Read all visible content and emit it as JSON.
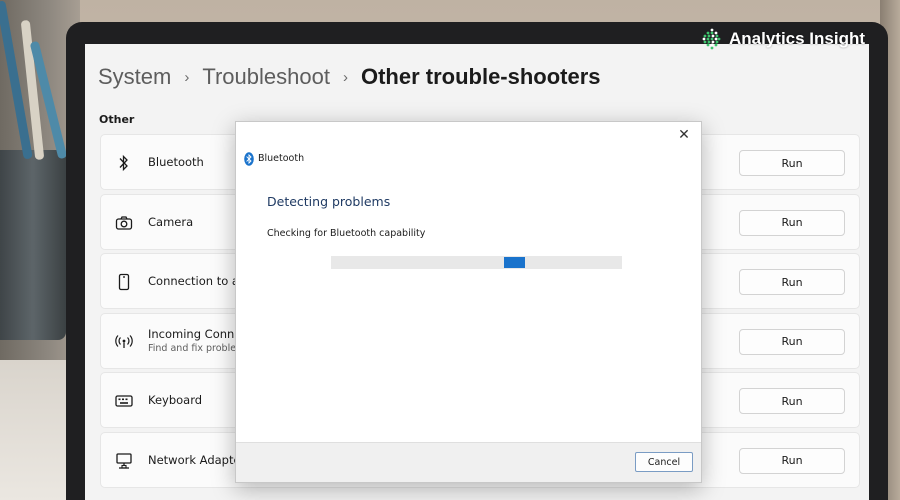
{
  "watermark": {
    "text": "Analytics Insight",
    "accent": "#3ec46d"
  },
  "breadcrumb": {
    "items": [
      "System",
      "Troubleshoot",
      "Other trouble-shooters"
    ],
    "separator": "›"
  },
  "section_label": "Other",
  "rows": [
    {
      "icon": "bluetooth-icon",
      "title": "Bluetooth",
      "subtitle": "",
      "button": "Run"
    },
    {
      "icon": "camera-icon",
      "title": "Camera",
      "subtitle": "",
      "button": "Run"
    },
    {
      "icon": "phone-icon",
      "title": "Connection to a W",
      "subtitle": "",
      "button": "Run"
    },
    {
      "icon": "antenna-icon",
      "title": "Incoming Connec",
      "subtitle": "Find and fix problen",
      "button": "Run"
    },
    {
      "icon": "keyboard-icon",
      "title": "Keyboard",
      "subtitle": "",
      "button": "Run"
    },
    {
      "icon": "network-adapter-icon",
      "title": "Network Adapter",
      "subtitle": "",
      "button": "Run"
    }
  ],
  "dialog": {
    "title": "Bluetooth",
    "close_glyph": "✕",
    "heading": "Detecting problems",
    "status": "Checking for Bluetooth capability",
    "progress": {
      "mode": "indeterminate",
      "chunk_position": 0.64,
      "color": "#1a73cc"
    },
    "cancel_label": "Cancel"
  },
  "colors": {
    "accent": "#1a73cc",
    "page_bg": "#f3f3f3",
    "card_bg": "#fbfbfb"
  }
}
